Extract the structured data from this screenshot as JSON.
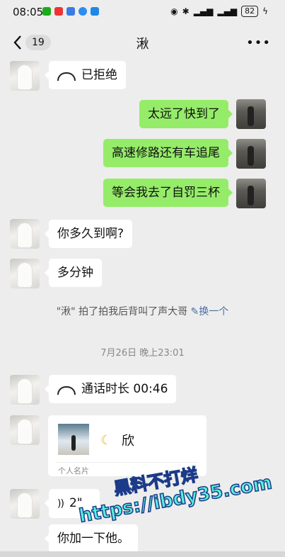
{
  "status_bar": {
    "time": "08:05",
    "battery": "82"
  },
  "header": {
    "back_count": "19",
    "title": "湫"
  },
  "messages": {
    "call_rejected": "已拒绝",
    "right1": "太远了快到了",
    "right2": "高速修路还有车追尾",
    "right3": "等会我去了自罚三杯",
    "left1": "你多久到啊?",
    "left2": "多分钟",
    "pat_text": "\"湫\" 拍了拍我后背叫了声大哥",
    "pat_link": "换一个",
    "time_sep": "7月26日 晚上23:01",
    "call_duration": "通话时长 00:46",
    "card_name": "欣",
    "card_footer": "个人名片",
    "voice_len": "2\"",
    "last": "你加一下他。"
  },
  "watermark": {
    "line1": "黑料不打烊",
    "line2": "https://ibdy35.com"
  }
}
